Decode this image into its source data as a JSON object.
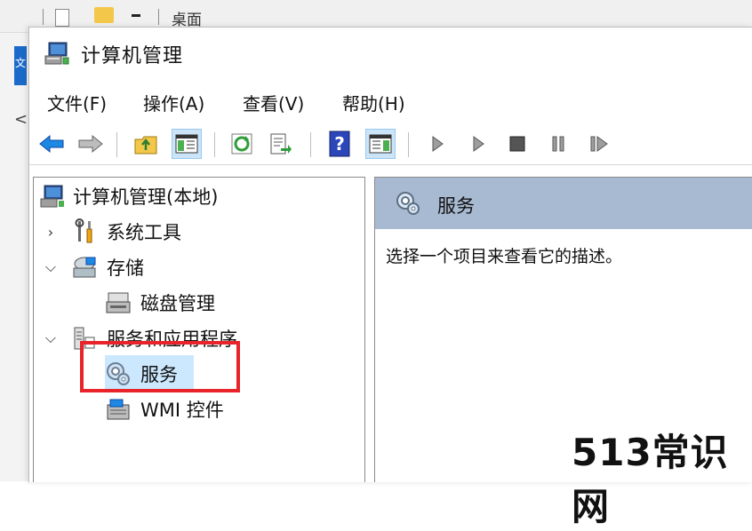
{
  "background": {
    "title": "桌面",
    "left_tab_letter": "文",
    "back_arrow": "<"
  },
  "window": {
    "title": "计算机管理"
  },
  "menu": {
    "file": "文件(F)",
    "action": "操作(A)",
    "view": "查看(V)",
    "help": "帮助(H)"
  },
  "toolbar": {
    "icons": [
      "back-arrow-icon",
      "forward-arrow-icon",
      "up-folder-icon",
      "show-hide-tree-icon",
      "refresh-icon",
      "export-list-icon",
      "help-icon",
      "show-hide-action-pane-icon",
      "play-icon",
      "play-alt-icon",
      "stop-icon",
      "pause-icon",
      "restart-icon"
    ]
  },
  "tree": {
    "root": "计算机管理(本地)",
    "system_tools": "系统工具",
    "storage": "存储",
    "disk_management": "磁盘管理",
    "services_apps": "服务和应用程序",
    "services": "服务",
    "wmi": "WMI 控件"
  },
  "detail": {
    "title": "服务",
    "description": "选择一个项目来查看它的描述。"
  },
  "watermark": "513常识网",
  "colors": {
    "selection": "#cce8ff",
    "highlight_border": "#e8242a",
    "detail_header": "#a8bad2"
  }
}
